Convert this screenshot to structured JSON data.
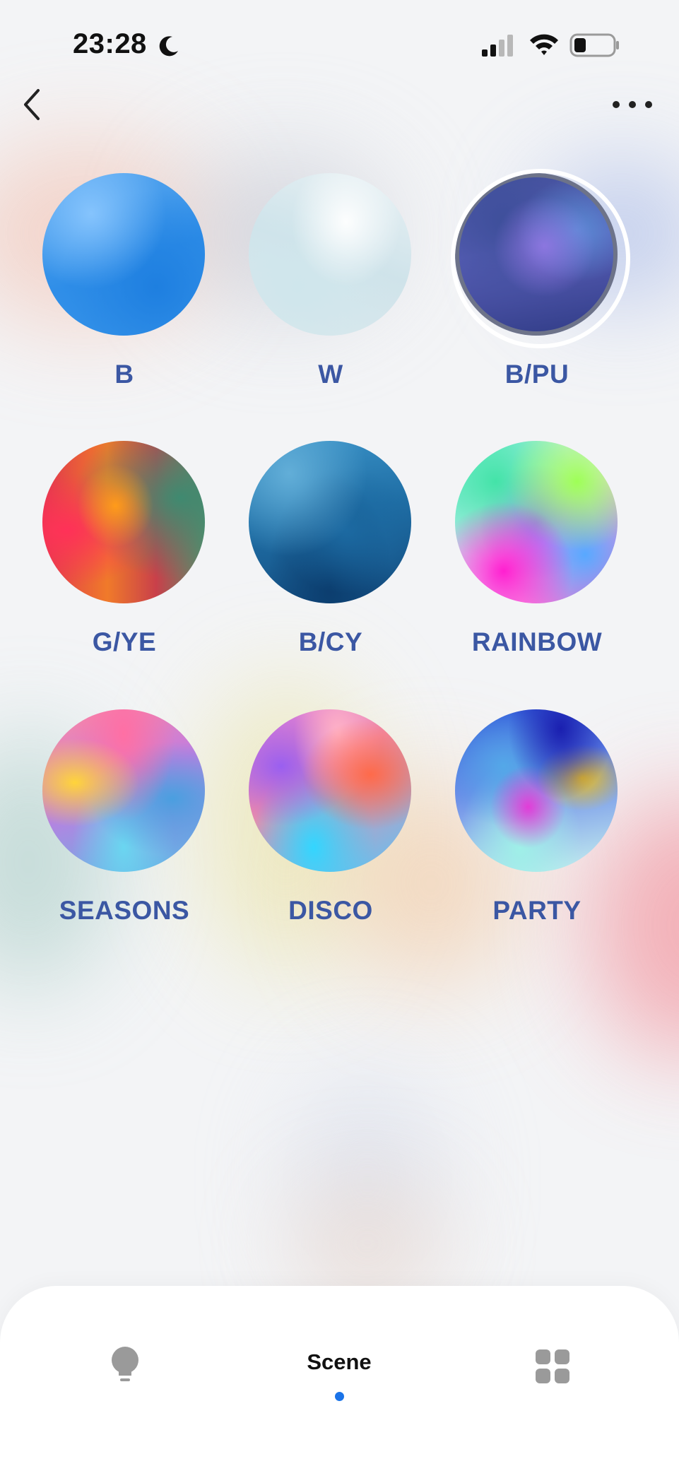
{
  "status_bar": {
    "time": "23:28",
    "icons": [
      "moon-icon",
      "cellular-signal-icon",
      "wifi-icon",
      "battery-icon"
    ]
  },
  "nav": {
    "back_icon": "chevron-left-icon",
    "more_icon": "more-dots-icon"
  },
  "scenes": [
    {
      "label": "B",
      "selected": false
    },
    {
      "label": "W",
      "selected": false
    },
    {
      "label": "B/PU",
      "selected": true
    },
    {
      "label": "G/YE",
      "selected": false
    },
    {
      "label": "B/CY",
      "selected": false
    },
    {
      "label": "RAINBOW",
      "selected": false
    },
    {
      "label": "SEASONS",
      "selected": false
    },
    {
      "label": "DISCO",
      "selected": false
    },
    {
      "label": "PARTY",
      "selected": false
    }
  ],
  "tab_bar": {
    "tabs": [
      {
        "icon": "bulb-icon",
        "label": "",
        "active": false
      },
      {
        "icon": "",
        "label": "Scene",
        "active": true
      },
      {
        "icon": "grid-icon",
        "label": "",
        "active": false
      }
    ]
  },
  "colors": {
    "label": "#3b57a3",
    "accent": "#1a73e8",
    "background": "#f3f4f6"
  }
}
